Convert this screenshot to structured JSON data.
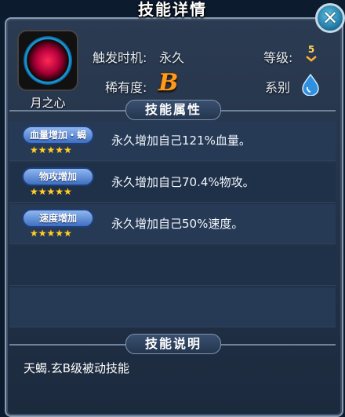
{
  "window": {
    "title": "技能详情",
    "close_label": "✕"
  },
  "skill": {
    "name": "月之心",
    "trigger_label": "触发时机:",
    "trigger_value": "永久",
    "level_label": "等级:",
    "level_value": "5",
    "rarity_label": "稀有度:",
    "rarity_value": "B",
    "element_label": "系别",
    "element_icon": "water-drop-icon"
  },
  "attributes_header": "技能属性",
  "attributes": [
    {
      "tag": "血量增加・蝎",
      "stars": "★★★★★",
      "star_count": 5,
      "text": "永久增加自己121%血量。"
    },
    {
      "tag": "物攻增加",
      "stars": "★★★★★",
      "star_count": 5,
      "text": "永久增加自己70.4%物攻。"
    },
    {
      "tag": "速度增加",
      "stars": "★★★★★",
      "star_count": 5,
      "text": "永久增加自己50%速度。"
    }
  ],
  "description_header": "技能说明",
  "description": "天蝎.玄B级被动技能",
  "colors": {
    "rarity": "#ff9a1a",
    "star": "#ffcf2e",
    "pill": "#5a86d6"
  }
}
